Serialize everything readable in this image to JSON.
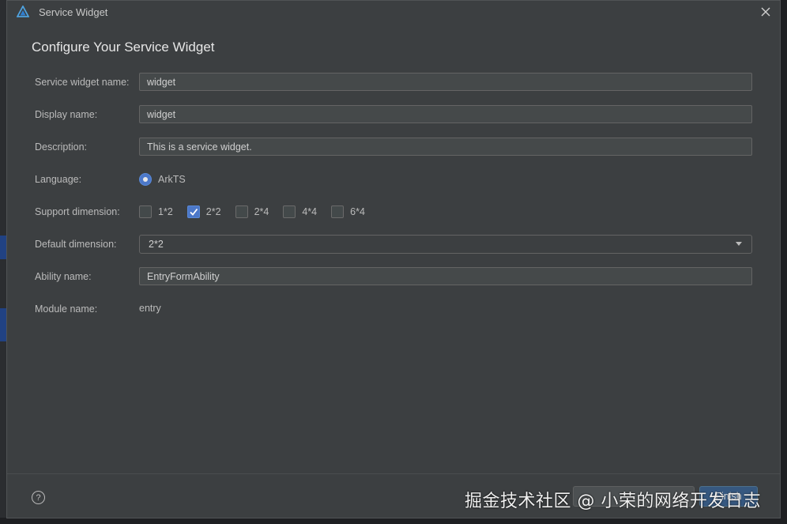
{
  "window": {
    "title": "Service Widget",
    "close_icon": "close-icon"
  },
  "heading": "Configure Your Service Widget",
  "form": {
    "service_widget_name": {
      "label": "Service widget name:",
      "value": "widget"
    },
    "display_name": {
      "label": "Display name:",
      "value": "widget"
    },
    "description": {
      "label": "Description:",
      "value": "This is a service widget."
    },
    "language": {
      "label": "Language:",
      "option": "ArkTS",
      "selected": true
    },
    "support_dimension": {
      "label": "Support dimension:",
      "options": [
        {
          "label": "1*2",
          "checked": false
        },
        {
          "label": "2*2",
          "checked": true
        },
        {
          "label": "2*4",
          "checked": false
        },
        {
          "label": "4*4",
          "checked": false
        },
        {
          "label": "6*4",
          "checked": false
        }
      ]
    },
    "default_dimension": {
      "label": "Default dimension:",
      "value": "2*2"
    },
    "ability_name": {
      "label": "Ability name:",
      "value": "EntryFormAbility"
    },
    "module_name": {
      "label": "Module name:",
      "value": "entry"
    }
  },
  "footer": {
    "help": "?",
    "finish_label": "Finish"
  },
  "watermark": "掘金技术社区 @ 小荣的网络开发日志",
  "colors": {
    "dialog_bg": "#3c3f41",
    "accent": "#4c78c9",
    "field_bg": "#45494a"
  }
}
